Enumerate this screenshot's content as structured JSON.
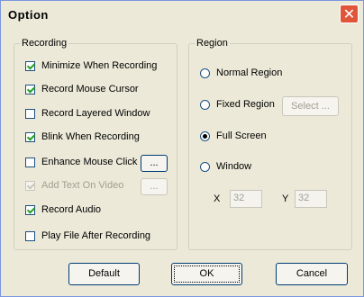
{
  "window": {
    "title": "Option",
    "close_glyph": "✕"
  },
  "recording": {
    "label": "Recording",
    "options": [
      {
        "label": "Minimize When Recording",
        "checked": true,
        "enabled": true
      },
      {
        "label": "Record Mouse Cursor",
        "checked": true,
        "enabled": true
      },
      {
        "label": "Record Layered Window",
        "checked": false,
        "enabled": true
      },
      {
        "label": "Blink When Recording",
        "checked": true,
        "enabled": true
      },
      {
        "label": "Enhance Mouse Click",
        "checked": false,
        "enabled": true
      },
      {
        "label": "Add Text On Video",
        "checked": true,
        "enabled": false
      },
      {
        "label": "Record Audio",
        "checked": true,
        "enabled": true
      },
      {
        "label": "Play File After Recording",
        "checked": false,
        "enabled": true
      }
    ],
    "more_label": "..."
  },
  "region": {
    "label": "Region",
    "options": [
      {
        "label": "Normal Region",
        "selected": false
      },
      {
        "label": "Fixed Region",
        "selected": false
      },
      {
        "label": "Full Screen",
        "selected": true
      },
      {
        "label": "Window",
        "selected": false
      }
    ],
    "select_label": "Select ...",
    "x_label": "X",
    "x_value": "32",
    "y_label": "Y",
    "y_value": "32"
  },
  "buttons": {
    "default": "Default",
    "ok": "OK",
    "cancel": "Cancel"
  }
}
